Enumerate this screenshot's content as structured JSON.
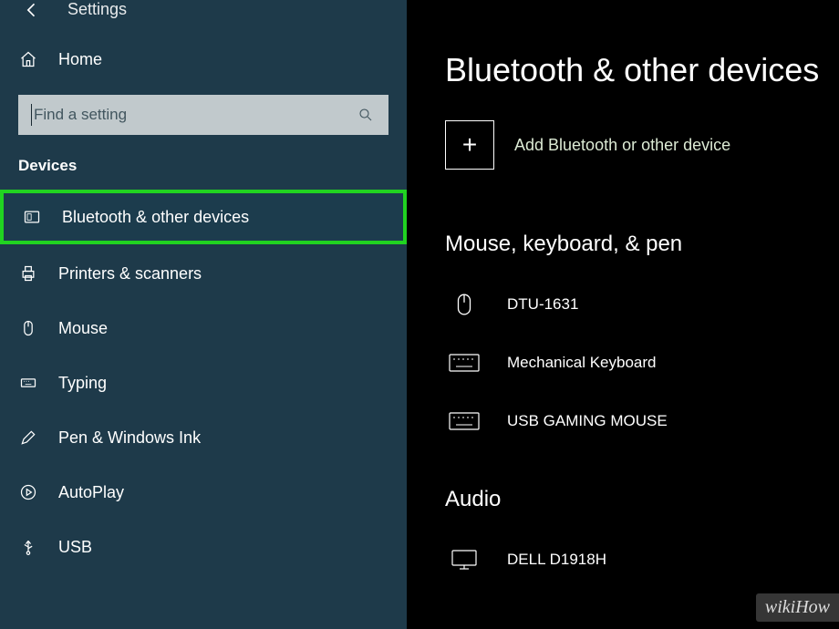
{
  "sidebar": {
    "back_label": "Settings",
    "home_label": "Home",
    "search_placeholder": "Find a setting",
    "category": "Devices",
    "items": [
      {
        "label": "Bluetooth & other devices",
        "icon": "bluetooth-devices-icon",
        "highlighted": true
      },
      {
        "label": "Printers & scanners",
        "icon": "printer-icon"
      },
      {
        "label": "Mouse",
        "icon": "mouse-icon"
      },
      {
        "label": "Typing",
        "icon": "keyboard-icon"
      },
      {
        "label": "Pen & Windows Ink",
        "icon": "pen-icon"
      },
      {
        "label": "AutoPlay",
        "icon": "autoplay-icon"
      },
      {
        "label": "USB",
        "icon": "usb-icon"
      }
    ]
  },
  "main": {
    "title": "Bluetooth & other devices",
    "add_label": "Add Bluetooth or other device",
    "sections": [
      {
        "header": "Mouse, keyboard, & pen",
        "devices": [
          {
            "label": "DTU-1631",
            "icon": "mouse-icon"
          },
          {
            "label": "Mechanical Keyboard",
            "icon": "keyboard-icon"
          },
          {
            "label": "USB GAMING MOUSE",
            "icon": "keyboard-icon"
          }
        ]
      },
      {
        "header": "Audio",
        "devices": [
          {
            "label": "DELL D1918H",
            "icon": "monitor-icon"
          }
        ]
      }
    ]
  },
  "watermark": "wikiHow",
  "colors": {
    "sidebar_bg": "#1e3a4a",
    "highlight_border": "#21d321",
    "main_bg": "#000000",
    "search_bg": "#c1c9cc"
  }
}
